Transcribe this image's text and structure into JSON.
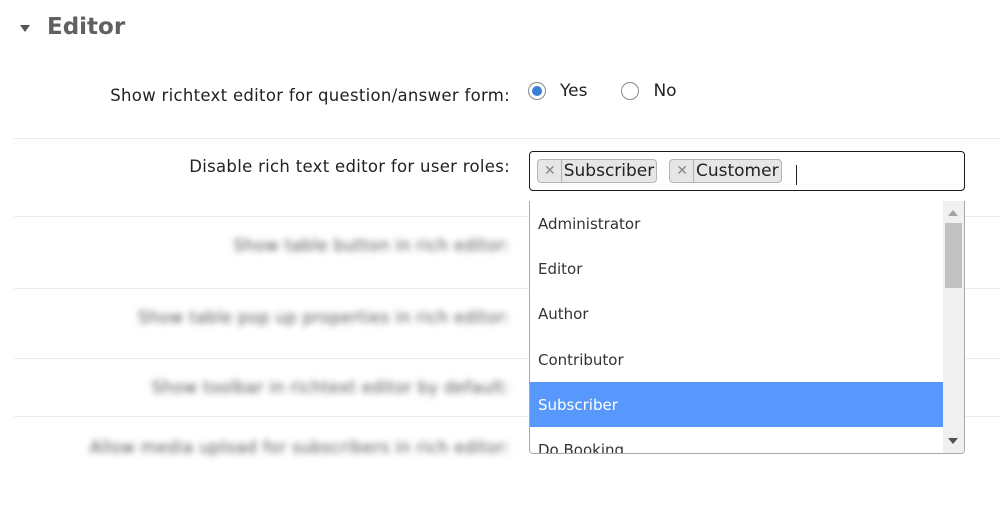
{
  "section": {
    "title": "Editor",
    "expanded": true
  },
  "settings": [
    {
      "label": "Show richtext editor for question/answer form:",
      "type": "radio",
      "options": [
        {
          "label": "Yes",
          "checked": true
        },
        {
          "label": "No",
          "checked": false
        }
      ]
    },
    {
      "label": "Disable rich text editor for user roles:",
      "type": "multiselect",
      "selected": [
        "Subscriber",
        "Customer"
      ],
      "dropdown_options": [
        "Administrator",
        "Editor",
        "Author",
        "Contributor",
        "Subscriber",
        "Do Booking"
      ],
      "highlighted": "Subscriber"
    },
    {
      "label": "Show table button in rich editor:",
      "blurred": true
    },
    {
      "label": "Show table pop up properties in rich editor:",
      "blurred": true
    },
    {
      "label": "Show toolbar in richtext editor by default:",
      "blurred": true
    },
    {
      "label": "Allow media upload for subscribers in rich editor:",
      "blurred": true
    }
  ],
  "icons": {
    "collapse": "caret-down-icon",
    "remove_chip": "close-icon",
    "scroll_up": "arrow-up-icon",
    "scroll_down": "arrow-down-icon"
  },
  "colors": {
    "highlight": "#5897fb",
    "radio_checked": "#3a7fd5",
    "section_title": "#606060"
  }
}
